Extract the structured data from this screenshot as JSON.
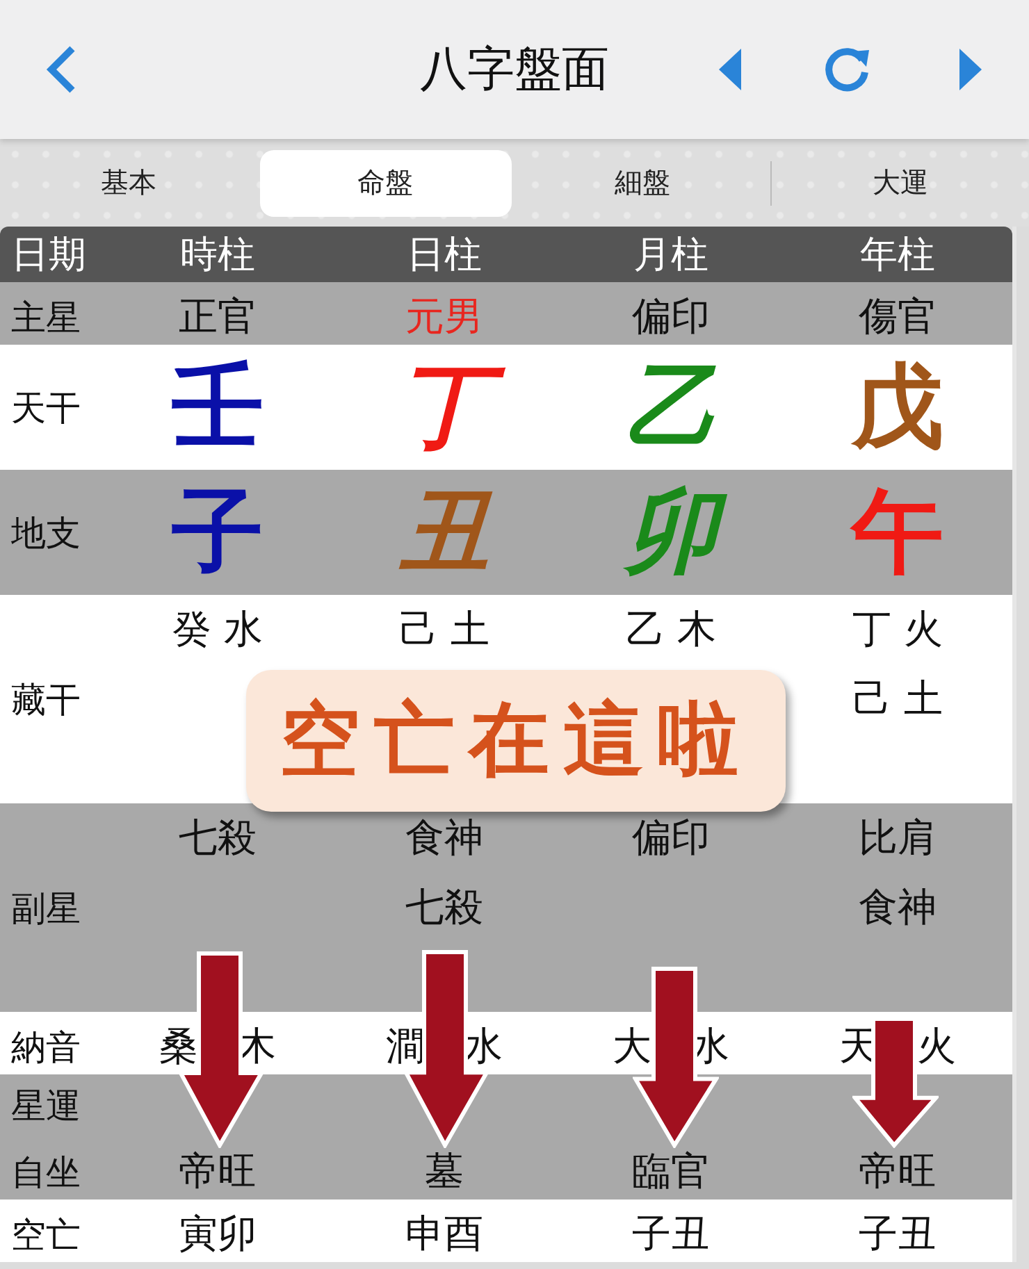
{
  "nav": {
    "title": "八字盤面"
  },
  "tabs": [
    {
      "label": "基本",
      "selected": false
    },
    {
      "label": "命盤",
      "selected": true
    },
    {
      "label": "細盤",
      "selected": false
    },
    {
      "label": "大運",
      "selected": false
    }
  ],
  "table": {
    "columns": [
      "日期",
      "時柱",
      "日柱",
      "月柱",
      "年柱"
    ],
    "rows": [
      {
        "kind": "text",
        "shaded": true,
        "cells": [
          {
            "lines": [
              "主星"
            ]
          },
          {
            "lines": [
              "正官"
            ]
          },
          {
            "lines": [
              "元男"
            ],
            "color": "#e8261f"
          },
          {
            "lines": [
              "偏印"
            ]
          },
          {
            "lines": [
              "傷官"
            ]
          }
        ]
      },
      {
        "kind": "glyph",
        "shaded": false,
        "cells": [
          {
            "lines": [
              "天干"
            ]
          },
          {
            "lines": [
              "壬"
            ],
            "color": "#0a10a8",
            "italic": false
          },
          {
            "lines": [
              "丁"
            ],
            "color": "#f01a14",
            "italic": true
          },
          {
            "lines": [
              "乙"
            ],
            "color": "#1a8a1a",
            "italic": true
          },
          {
            "lines": [
              "戊"
            ],
            "color": "#a0561a",
            "italic": false
          }
        ]
      },
      {
        "kind": "glyph",
        "shaded": true,
        "cells": [
          {
            "lines": [
              "地支"
            ]
          },
          {
            "lines": [
              "子"
            ],
            "color": "#0a10a8",
            "italic": false
          },
          {
            "lines": [
              "丑"
            ],
            "color": "#a0561a",
            "italic": true
          },
          {
            "lines": [
              "卯"
            ],
            "color": "#1a8a1a",
            "italic": true
          },
          {
            "lines": [
              "午"
            ],
            "color": "#f01a14",
            "italic": false
          }
        ]
      },
      {
        "kind": "multi",
        "shaded": false,
        "cells": [
          {
            "lines": [
              "藏干"
            ]
          },
          {
            "lines": [
              "癸 水"
            ]
          },
          {
            "lines": [
              "己 土"
            ]
          },
          {
            "lines": [
              "乙 木"
            ]
          },
          {
            "lines": [
              "丁 火",
              "己 土"
            ]
          }
        ]
      },
      {
        "kind": "multi",
        "shaded": true,
        "cells": [
          {
            "lines": [
              "副星"
            ]
          },
          {
            "lines": [
              "七殺"
            ]
          },
          {
            "lines": [
              "食神",
              "七殺"
            ]
          },
          {
            "lines": [
              "偏印"
            ]
          },
          {
            "lines": [
              "比肩",
              "食神"
            ]
          }
        ]
      },
      {
        "kind": "text",
        "shaded": false,
        "cells": [
          {
            "lines": [
              "納音"
            ]
          },
          {
            "lines": [
              "桑　木"
            ]
          },
          {
            "lines": [
              "澗　水"
            ]
          },
          {
            "lines": [
              "大　水"
            ]
          },
          {
            "lines": [
              "天　火"
            ]
          }
        ]
      },
      {
        "kind": "text",
        "shaded": true,
        "cells": [
          {
            "lines": [
              "星運"
            ]
          },
          {},
          {},
          {},
          {}
        ]
      },
      {
        "kind": "text",
        "shaded": true,
        "cells": [
          {
            "lines": [
              "自坐"
            ]
          },
          {
            "lines": [
              "帝旺"
            ]
          },
          {
            "lines": [
              "墓"
            ]
          },
          {
            "lines": [
              "臨官"
            ]
          },
          {
            "lines": [
              "帝旺"
            ]
          }
        ]
      },
      {
        "kind": "text",
        "shaded": false,
        "cells": [
          {
            "lines": [
              "空亡"
            ]
          },
          {
            "lines": [
              "寅卯"
            ]
          },
          {
            "lines": [
              "申酉"
            ]
          },
          {
            "lines": [
              "子丑"
            ]
          },
          {
            "lines": [
              "子丑"
            ]
          }
        ]
      }
    ]
  },
  "callout": {
    "text": "空亡在這啦"
  },
  "arrows": [
    {
      "kind": "down"
    },
    {
      "kind": "down"
    },
    {
      "kind": "down"
    },
    {
      "kind": "down"
    }
  ]
}
